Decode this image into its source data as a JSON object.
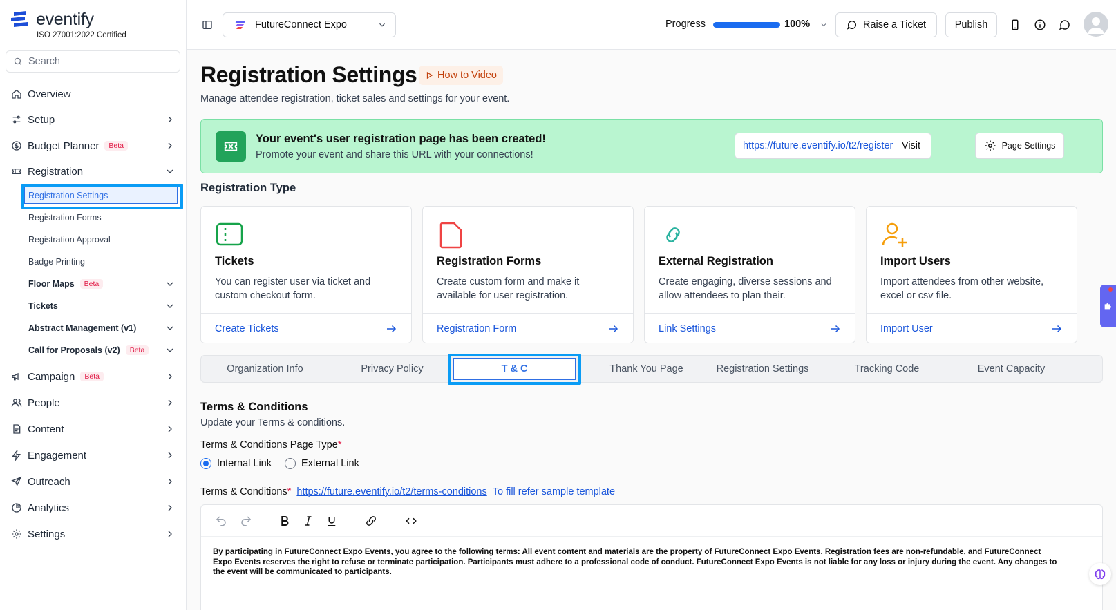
{
  "sidebar": {
    "logo_text": "eventify",
    "certification": "ISO 27001:2022 Certified",
    "search_placeholder": "Search",
    "items": [
      {
        "label": "Overview"
      },
      {
        "label": "Setup"
      },
      {
        "label": "Budget Planner",
        "badge": "Beta"
      },
      {
        "label": "Registration"
      },
      {
        "label": "Campaign",
        "badge": "Beta"
      },
      {
        "label": "People"
      },
      {
        "label": "Content"
      },
      {
        "label": "Engagement"
      },
      {
        "label": "Outreach"
      },
      {
        "label": "Analytics"
      },
      {
        "label": "Settings"
      }
    ],
    "registration_sub": [
      {
        "label": "Registration Settings"
      },
      {
        "label": "Registration Forms"
      },
      {
        "label": "Registration Approval"
      },
      {
        "label": "Badge Printing"
      },
      {
        "label": "Floor Maps",
        "badge": "Beta"
      },
      {
        "label": "Tickets"
      },
      {
        "label": "Abstract Management (v1)"
      },
      {
        "label": "Call for Proposals (v2)",
        "badge": "Beta"
      }
    ]
  },
  "topbar": {
    "event_name": "FutureConnect Expo",
    "progress_label": "Progress",
    "progress_value": "100%",
    "progress_fraction": 1.0,
    "raise_ticket": "Raise a Ticket",
    "publish": "Publish"
  },
  "page": {
    "title": "Registration Settings",
    "how_to_video": "How to Video",
    "subtitle": "Manage attendee registration, ticket sales and settings for your event."
  },
  "banner": {
    "title": "Your event's user registration page has been created!",
    "subtitle": "Promote your event and share this URL with your connections!",
    "url": "https://future.eventify.io/t2/register",
    "visit": "Visit",
    "page_settings": "Page Settings"
  },
  "registration_type": {
    "title": "Registration Type",
    "cards": [
      {
        "title": "Tickets",
        "desc": "You can register user via ticket and custom checkout form.",
        "action": "Create Tickets"
      },
      {
        "title": "Registration Forms",
        "desc": "Create custom form and make it available for user registration.",
        "action": "Registration Form"
      },
      {
        "title": "External Registration",
        "desc": "Create engaging, diverse sessions and allow attendees to plan their.",
        "action": "Link Settings"
      },
      {
        "title": "Import Users",
        "desc": "Import attendees from other website, excel or csv file.",
        "action": "Import User"
      }
    ]
  },
  "tabs": [
    {
      "label": "Organization Info"
    },
    {
      "label": "Privacy Policy"
    },
    {
      "label": "T & C"
    },
    {
      "label": "Thank You Page"
    },
    {
      "label": "Registration Settings"
    },
    {
      "label": "Tracking Code"
    },
    {
      "label": "Event Capacity"
    }
  ],
  "terms": {
    "title": "Terms & Conditions",
    "subtitle": "Update your Terms & conditions.",
    "page_type_label": "Terms & Conditions Page Type",
    "required_mark": "*",
    "option_internal": "Internal Link",
    "option_external": "External Link",
    "link_label": "Terms & Conditions",
    "link_url": "https://future.eventify.io/t2/terms-conditions",
    "refer_text": "To fill refer sample template",
    "body": "By participating in FutureConnect Expo Events, you agree to the following terms: All event content and materials are the property of FutureConnect Expo Events. Registration fees are non-refundable, and FutureConnect Expo Events reserves the right to refuse or terminate participation. Participants must adhere to a professional code of conduct. FutureConnect Expo Events is not liable for any loss or injury during the event. Any changes to the event will be communicated to participants."
  },
  "colors": {
    "accent": "#1a56db",
    "highlight": "#0a9cf5",
    "banner_bg": "#b9f5d0",
    "badge_text": "#e11d48"
  }
}
